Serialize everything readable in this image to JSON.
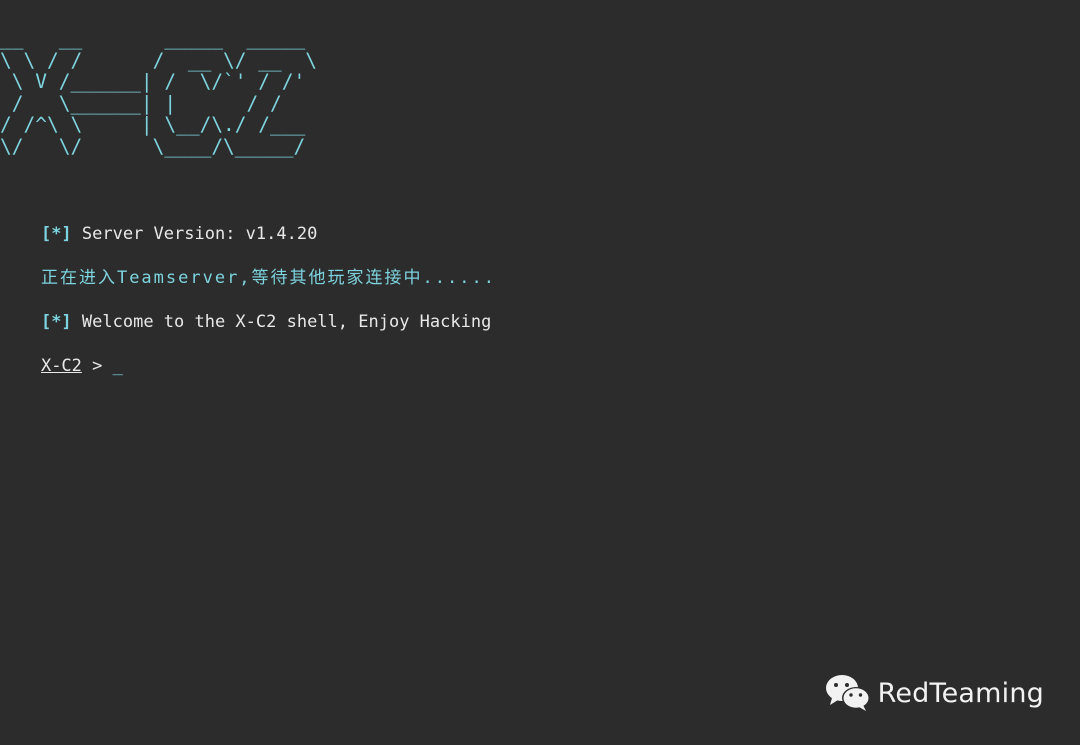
{
  "banner": {
    "art": "__   __       _____  _____\n\\ \\ / /      /  __ \\/ __  \\\n \\ V /______| /  \\/`' / /'\n /   \\______| |      / /\n/ /^\\ \\     | \\__/\\./ /___\n\\/   \\/      \\____/\\_____/",
    "color": "#7dd3de"
  },
  "output": {
    "version_tag": "[*]",
    "version_text": " Server Version: v1.4.20",
    "waiting_text": "正在进入Teamserver,等待其他玩家连接中......",
    "welcome_tag": "[*]",
    "welcome_text": " Welcome to the X-C2 shell, Enjoy Hacking"
  },
  "prompt": {
    "name": "X-C2",
    "separator": " > ",
    "cursor": "_"
  },
  "watermark": {
    "icon": "wechat-icon",
    "text": "RedTeaming"
  },
  "colors": {
    "background": "#2c2c2c",
    "accent": "#7dd3de",
    "text": "#e8e8e8"
  }
}
